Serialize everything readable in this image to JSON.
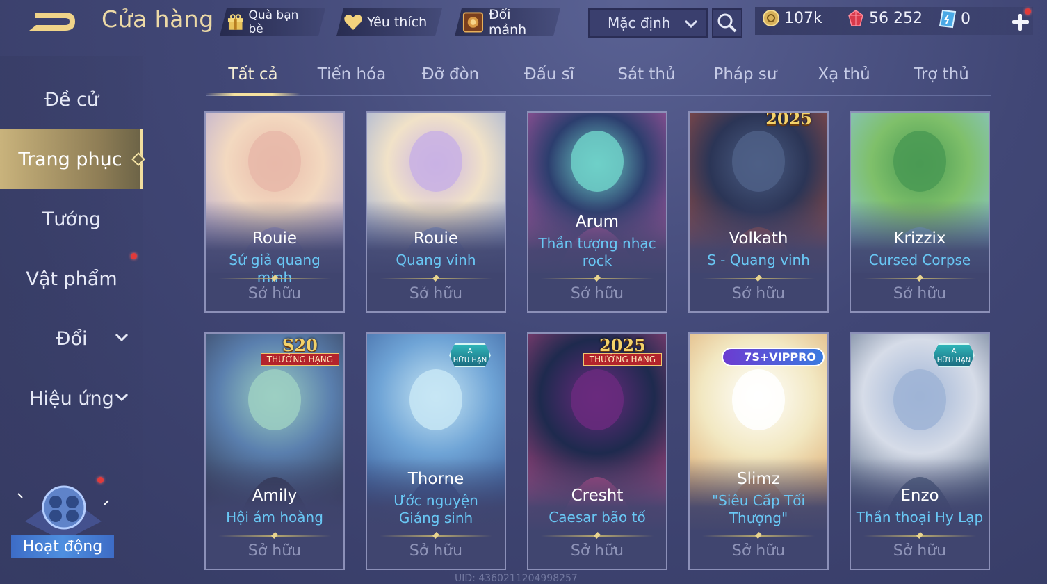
{
  "header": {
    "title": "Cửa hàng",
    "gift_label": "Quà bạn bè",
    "favorite_label": "Yêu thích",
    "exchange_label": "Đổi mảnh",
    "sort_value": "Mặc định",
    "gold": "107k",
    "gems": "56 252",
    "vouchers": "0"
  },
  "sidebar": {
    "items": [
      {
        "label": "Đề cử"
      },
      {
        "label": "Trang phục"
      },
      {
        "label": "Tướng"
      },
      {
        "label": "Vật phẩm"
      },
      {
        "label": "Đổi"
      },
      {
        "label": "Hiệu ứng"
      }
    ],
    "active": "Trang phục",
    "activity_label": "Hoạt động"
  },
  "tabs": [
    "Tất cả",
    "Tiến hóa",
    "Đỡ đòn",
    "Đấu sĩ",
    "Sát thủ",
    "Pháp sư",
    "Xạ thủ",
    "Trợ thủ"
  ],
  "active_tab": "Tất cả",
  "cards": [
    {
      "hero": "Rouie",
      "skin": "Sứ giả quang minh",
      "status": "Sở hữu",
      "badge_top": "",
      "badge_ribbon": ""
    },
    {
      "hero": "Rouie",
      "skin": "Quang vinh",
      "status": "Sở hữu",
      "badge_top": "",
      "badge_ribbon": ""
    },
    {
      "hero": "Arum",
      "skin": "Thần tượng nhạc rock",
      "status": "Sở hữu",
      "badge_top": "",
      "badge_ribbon": ""
    },
    {
      "hero": "Volkath",
      "skin": "S - Quang vinh",
      "status": "Sở hữu",
      "badge_top": "2025",
      "badge_ribbon": ""
    },
    {
      "hero": "Krizzix",
      "skin": "Cursed Corpse",
      "status": "Sở hữu",
      "badge_top": "",
      "badge_ribbon": ""
    },
    {
      "hero": "Amily",
      "skin": "Hội ám hoàng",
      "status": "Sở hữu",
      "badge_top": "S20",
      "badge_ribbon": "THƯỞNG HẠNG"
    },
    {
      "hero": "Thorne",
      "skin": "Ước nguyện Giáng sinh",
      "status": "Sở hữu",
      "badge_top": "A",
      "badge_ribbon": "HỮU HẠN"
    },
    {
      "hero": "Cresht",
      "skin": "Caesar bão tố",
      "status": "Sở hữu",
      "badge_top": "2025",
      "badge_ribbon": "THƯỞNG HẠNG"
    },
    {
      "hero": "Slimz",
      "skin": "\"Siêu Cấp Tối Thượng\"",
      "status": "Sở hữu",
      "badge_top": "7S+VIPPRO",
      "badge_ribbon": ""
    },
    {
      "hero": "Enzo",
      "skin": "Thần thoại Hy Lạp",
      "status": "Sở hữu",
      "badge_top": "A",
      "badge_ribbon": "HỮU HẠN"
    }
  ],
  "footer": {
    "uid": "UID: 4360211204998257"
  },
  "colors": {
    "accent_gold": "#ecd9a6",
    "skin_name_blue": "#69c7f4",
    "owned_gray": "#8f94b8",
    "active_sidebar": "#c9b37c"
  }
}
